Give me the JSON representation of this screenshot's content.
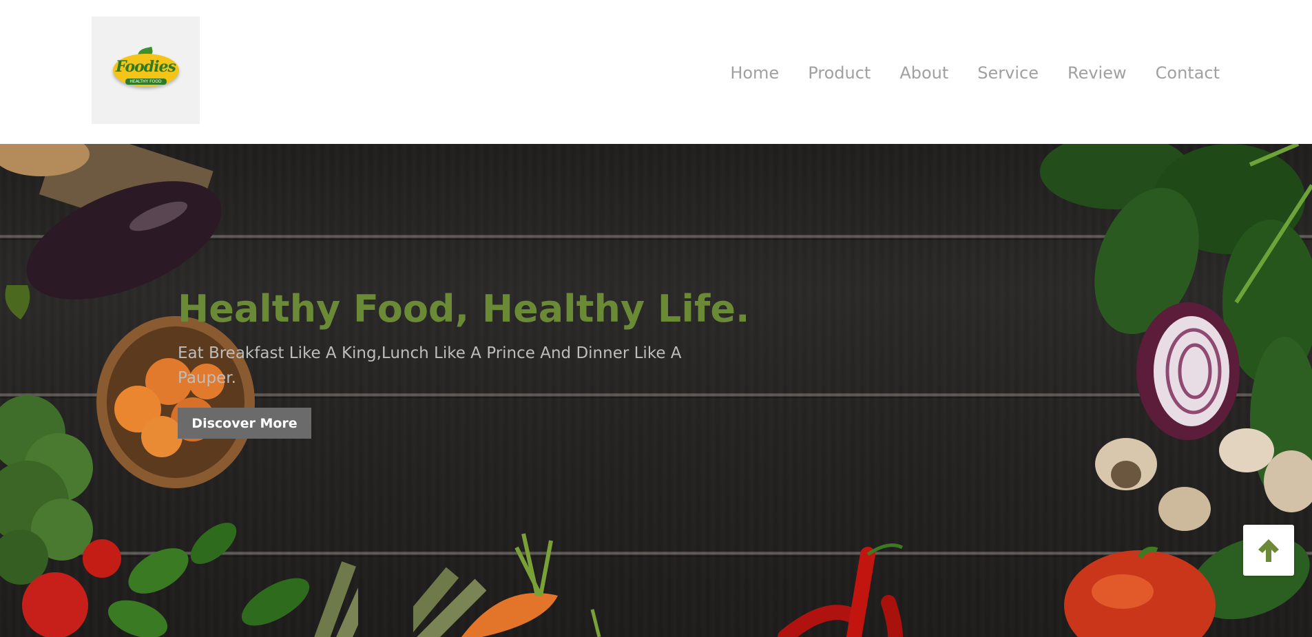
{
  "brand": {
    "logo_word": "Foodies",
    "logo_tagline": "HEALTHY FOOD"
  },
  "nav": {
    "items": [
      {
        "label": "Home"
      },
      {
        "label": "Product"
      },
      {
        "label": "About"
      },
      {
        "label": "Service"
      },
      {
        "label": "Review"
      },
      {
        "label": "Contact"
      }
    ]
  },
  "hero": {
    "title": "Healthy Food, Healthy Life.",
    "subtitle": "Eat Breakfast Like A King,Lunch Like A Prince And Dinner Like A Pauper.",
    "cta_label": "Discover More"
  },
  "scroll_top": {
    "icon": "arrow-up-icon"
  },
  "colors": {
    "accent_green": "#6a8a36",
    "nav_text": "#a0a0a0",
    "cta_bg": "#6b6b6b",
    "hero_bg": "#262524",
    "logo_bg": "#f1f1f1"
  }
}
